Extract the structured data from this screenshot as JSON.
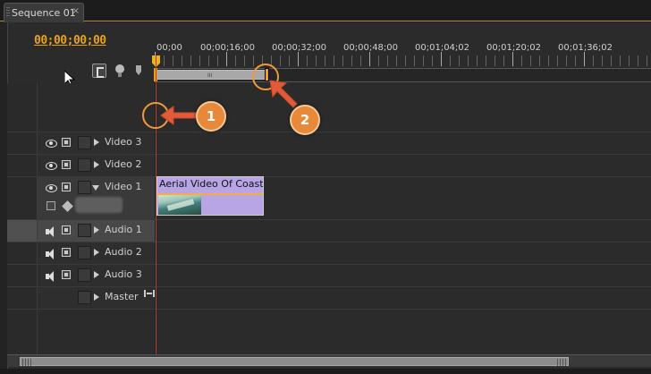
{
  "tab": {
    "title": "Sequence 01",
    "close": "×"
  },
  "timecode": "00;00;00;00",
  "ruler": {
    "labels": [
      "00;00",
      "00;00;16;00",
      "00;00;32;00",
      "00;00;48;00",
      "00;01;04;02",
      "00;01;20;02",
      "00;01;36;02"
    ]
  },
  "tracks": {
    "video3": {
      "label": "Video 3"
    },
    "video2": {
      "label": "Video 2"
    },
    "video1": {
      "label": "Video 1"
    },
    "audio1": {
      "label": "Audio 1"
    },
    "audio2": {
      "label": "Audio 2"
    },
    "audio3": {
      "label": "Audio 3"
    },
    "master": {
      "label": "Master"
    }
  },
  "clip": {
    "title": "Aerial Video Of Coastli"
  },
  "callouts": {
    "one": "1",
    "two": "2"
  },
  "colors": {
    "timecode": "#e7a21a",
    "accent_orange": "#e8893a",
    "playhead": "#c2392b",
    "clip": "#b7a5e6"
  },
  "icons": [
    "snap-icon",
    "add-marker-icon",
    "encore-marker-icon",
    "eye-icon",
    "film-icon",
    "speaker-icon",
    "master-icon"
  ]
}
